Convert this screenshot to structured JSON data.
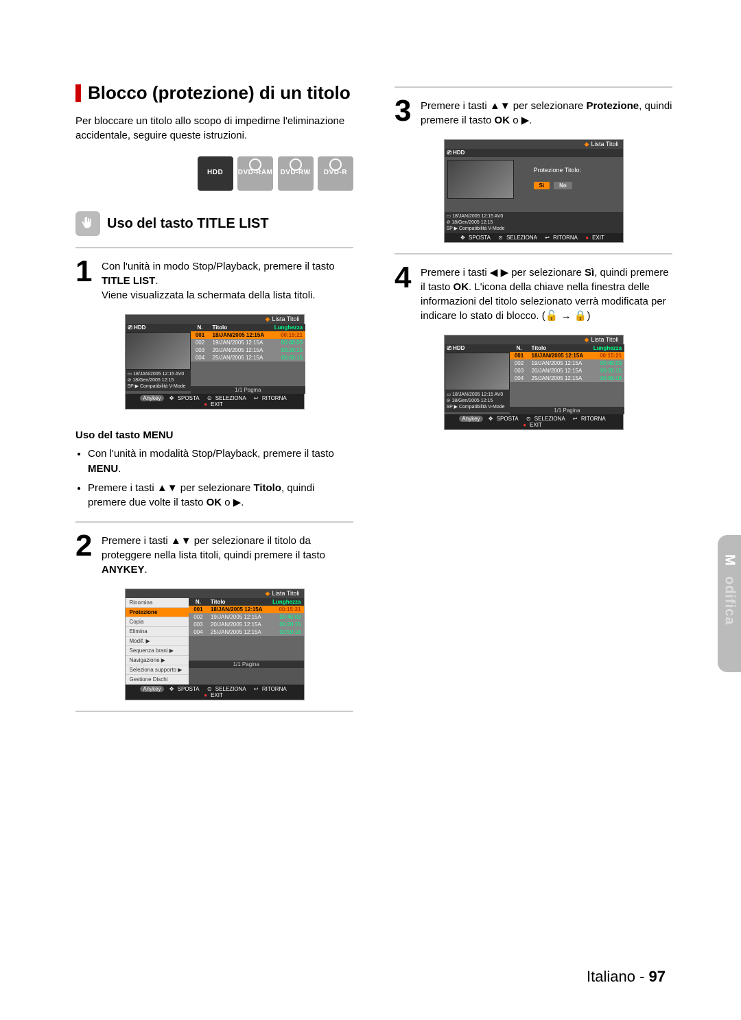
{
  "section": {
    "heading": "Blocco (protezione) di un titolo",
    "intro": "Per bloccare un titolo allo scopo di impedirne l'eliminazione accidentale, seguire queste istruzioni."
  },
  "media_badges": [
    "HDD",
    "DVD-RAM",
    "DVD-RW",
    "DVD-R"
  ],
  "subhead": "Uso del tasto TITLE LIST",
  "step1": {
    "text_a": "Con l'unità in modo Stop/Playback, premere il tasto ",
    "key": "TITLE LIST",
    "text_b": "Viene visualizzata la schermata della lista titoli."
  },
  "menu_sub": {
    "heading": "Uso del tasto MENU",
    "bullet1_a": "Con l'unità in modalità Stop/Playback, premere il tasto ",
    "bullet1_key": "MENU",
    "bullet2_a": "Premere i tasti ▲▼ per selezionare ",
    "bullet2_bold": "Titolo",
    "bullet2_b": ", quindi premere due volte il tasto ",
    "bullet2_key": "OK",
    "bullet2_c": " o ▶."
  },
  "step2": {
    "text_a": "Premere i tasti ▲▼ per selezionare il titolo da proteggere nella lista titoli, quindi premere il tasto ",
    "key": "ANYKEY"
  },
  "step3": {
    "text_a": "Premere i tasti ▲▼ per selezionare ",
    "bold": "Protezione",
    "text_b": ", quindi premere il tasto ",
    "key": "OK",
    "text_c": " o ▶."
  },
  "step4": {
    "text_a": "Premere i tasti ◀ ▶ per selezionare ",
    "bold": "Sì",
    "text_b": ", quindi premere il tasto ",
    "key": "OK",
    "text_c": ". L'icona della chiave nella finestra delle informazioni del titolo selezionato verrà modificata per indicare lo stato di blocco."
  },
  "osd": {
    "list_caption": {
      "diamond": "Lista Titoli"
    },
    "drive": "HDD",
    "headers": {
      "n": "N.",
      "title": "Titolo",
      "length": "Lunghezza"
    },
    "rows": [
      {
        "n": "001",
        "title": "18/JAN/2005 12:15A",
        "len": "00:15:21",
        "sel": true
      },
      {
        "n": "002",
        "title": "19/JAN/2005 12:15A",
        "len": "00:40:03",
        "sel": false
      },
      {
        "n": "003",
        "title": "20/JAN/2005 12:15A",
        "len": "00:20:15",
        "sel": false
      },
      {
        "n": "004",
        "title": "25/JAN/2005 12:15A",
        "len": "00:50:16",
        "sel": false
      }
    ],
    "meta": {
      "line1": "18/JAN/2005 12:15 AV0",
      "line2": "18/Gen/2005 12:15",
      "line3": "SP ▶ Compatibilità V-Mode"
    },
    "pagination": "1/1 Pagina",
    "help": {
      "anykey": "Anykey",
      "move": "SPOSTA",
      "select": "SELEZIONA",
      "return": "RITORNA",
      "exit": "EXIT"
    },
    "anykey_menu": [
      "Rinomina",
      "Protezione",
      "Copia",
      "Elimina",
      "Modif.",
      "Sequenza brani",
      "Navigazione",
      "Seleziona supporto",
      "Gestione Dischi"
    ],
    "anykey_selected_index": 1,
    "anykey_arrow_from_index": 4,
    "protect": {
      "title": "Protezione Titolo:",
      "yes": "Sì",
      "no": "No"
    }
  },
  "side_tab": {
    "bold": "M",
    "rest": "odifica"
  },
  "footer": {
    "lang": "Italiano ",
    "dash": "- ",
    "page": "97"
  }
}
